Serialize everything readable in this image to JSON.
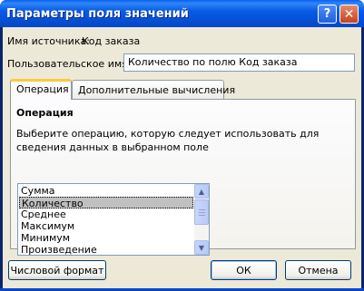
{
  "window": {
    "title": "Параметры поля значений",
    "help_glyph": "?",
    "close_glyph": "✕"
  },
  "source": {
    "label": "Имя источника:",
    "value": "Код заказа"
  },
  "custom_name": {
    "label": "Пользовательское имя:",
    "value": "Количество по полю Код заказа"
  },
  "tabs": [
    {
      "label": "Операция",
      "active": true
    },
    {
      "label": "Дополнительные вычисления",
      "active": false
    }
  ],
  "operation": {
    "group_title": "Операция",
    "description": "Выберите операцию, которую следует использовать для сведения данных в выбранном поле",
    "items": [
      "Сумма",
      "Количество",
      "Среднее",
      "Максимум",
      "Минимум",
      "Произведение"
    ],
    "selected": "Количество"
  },
  "buttons": {
    "number_format": "Числовой формат",
    "ok": "ОК",
    "cancel": "Отмена"
  },
  "colors": {
    "titlebar": "#0a5be6",
    "client_bg": "#ece9d8",
    "active_tab_accent": "#ffc83c",
    "selection": "#c0c0c0"
  }
}
